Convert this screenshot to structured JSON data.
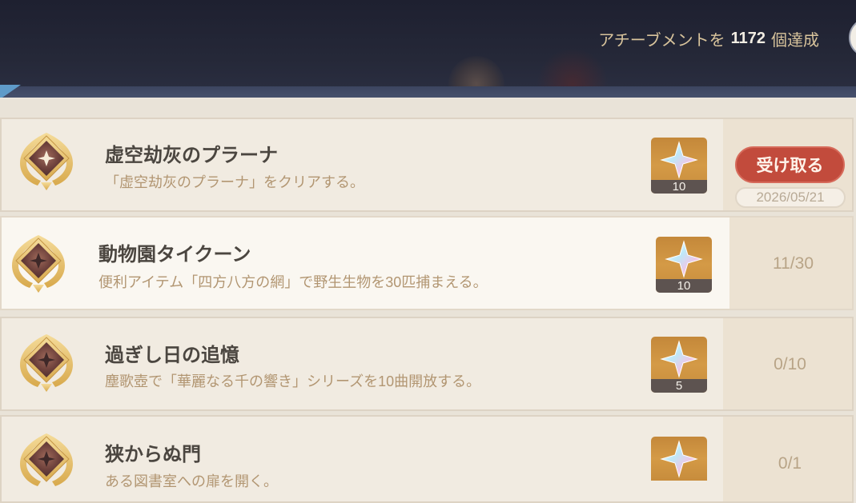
{
  "header": {
    "prefix": "アチーブメントを",
    "count": "1172",
    "suffix": "個達成"
  },
  "achievements": [
    {
      "title": "虚空劫灰のプラーナ",
      "description": "「虚空劫灰のプラーナ」をクリアする。",
      "reward_count": "10",
      "reward_icon": "primogem-icon",
      "status": "claimable",
      "claim_label": "受け取る",
      "date": "2026/05/21"
    },
    {
      "title": "動物園タイクーン",
      "description": "便利アイテム「四方八方の網」で野生生物を30匹捕まえる。",
      "reward_count": "10",
      "reward_icon": "primogem-icon",
      "progress": "11/30",
      "progress_fraction": 0.367
    },
    {
      "title": "過ぎし日の追憶",
      "description": "塵歌壺で「華麗なる千の響き」シリーズを10曲開放する。",
      "reward_count": "5",
      "reward_icon": "primogem-icon",
      "progress": "0/10",
      "progress_fraction": 0
    },
    {
      "title": "狭からぬ門",
      "description": "ある図書室への扉を開く。",
      "reward_count": "",
      "reward_icon": "primogem-icon",
      "progress": "0/1",
      "progress_fraction": 0
    }
  ],
  "colors": {
    "claim_button": "#c24b3c",
    "title_text": "#4b4640",
    "desc_text": "#b29672",
    "header_bg": "#1e2030"
  }
}
